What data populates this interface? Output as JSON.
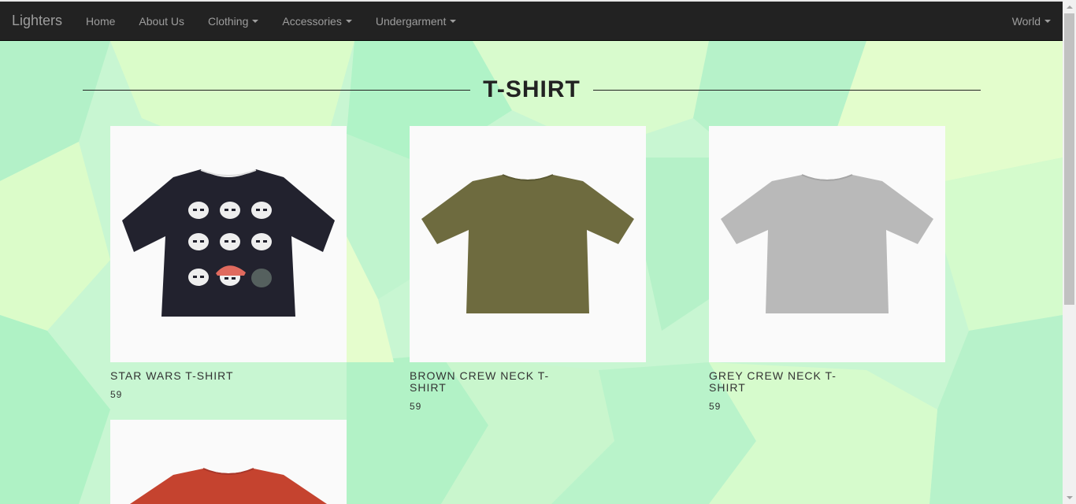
{
  "navbar": {
    "brand": "Lighters",
    "items": [
      {
        "label": "Home"
      },
      {
        "label": "About Us"
      },
      {
        "label": "Clothing"
      },
      {
        "label": "Accessories"
      },
      {
        "label": "Undergarment"
      }
    ],
    "right_label": "World"
  },
  "section": {
    "title": "T-SHIRT"
  },
  "products": [
    {
      "name": "STAR WARS T-SHIRT",
      "price": "59",
      "shirt_color": "#22222e",
      "icon": "star-wars-tshirt-image"
    },
    {
      "name": "BROWN CREW NECK T-SHIRT",
      "price": "59",
      "shirt_color": "#6e6b3f",
      "icon": "brown-tshirt-image"
    },
    {
      "name": "GREY CREW NECK T-SHIRT",
      "price": "59",
      "shirt_color": "#b9b9b9",
      "icon": "grey-tshirt-image"
    },
    {
      "name": "",
      "price": "",
      "shirt_color": "#c5432f",
      "icon": "red-tshirt-image"
    }
  ],
  "colors": {
    "navbar_bg": "#222222",
    "nav_text": "#9d9d9d",
    "background": "#c4f5cf"
  }
}
